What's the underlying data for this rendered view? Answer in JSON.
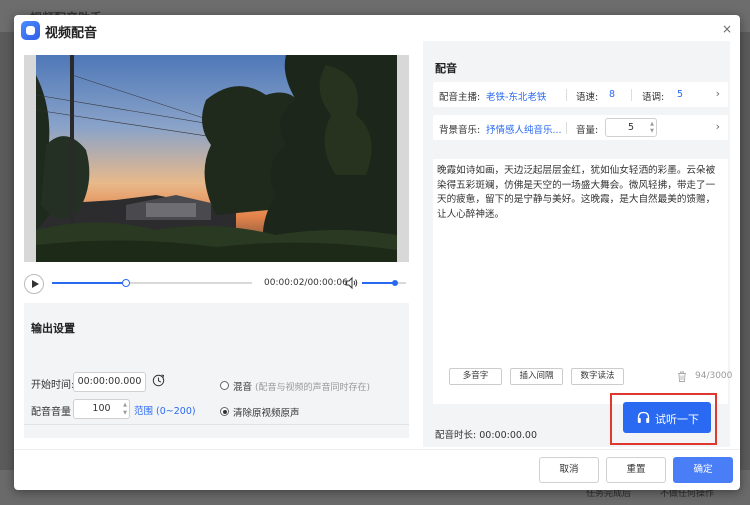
{
  "background": {
    "app_title": "视频配音助手",
    "bottom_status": "任务完成后",
    "bottom_option": "不做任何操作"
  },
  "dialog": {
    "title": "视频配音",
    "close_icon": "×"
  },
  "player": {
    "time_display": "00:00:02/00:00:06",
    "progress": 0.37,
    "volume": 0.75
  },
  "output": {
    "title": "输出设置",
    "start_time_label": "开始时间:",
    "start_time_value": "00:00:00.000",
    "dub_volume_label": "配音音量",
    "dub_volume_value": "100",
    "range_label": "范围",
    "range_hint": "(0~200)",
    "mix_label": "混音",
    "mix_hint": "(配音与视频的声音同时存在)",
    "remove_label": "清除原视频原声",
    "selected_mode": "remove"
  },
  "dub": {
    "title": "配音",
    "anchor_label": "配音主播:",
    "anchor_value": "老铁-东北老铁",
    "speed_label": "语速:",
    "speed_value": "8",
    "pitch_label": "语调:",
    "pitch_value": "5",
    "bgm_label": "背景音乐:",
    "bgm_value": "抒情感人纯音乐...",
    "volume_label": "音量:",
    "volume_value": "5",
    "text": "晚霞如诗如画，天边泛起层层金红，犹如仙女轻洒的彩墨。云朵被染得五彩斑斓，仿佛是天空的一场盛大舞会。微风轻拂，带走了一天的疲惫，留下的是宁静与美好。这晚霞，是大自然最美的馈赠，让人心醉神迷。",
    "polyphone_btn": "多音字",
    "pause_btn": "插入间隔",
    "number_btn": "数字读法",
    "char_count": "94/3000",
    "duration_label": "配音时长:",
    "duration_value": "00:00:00.00",
    "listen_btn": "试听一下"
  },
  "footer": {
    "cancel": "取消",
    "reset": "重置",
    "confirm": "确定"
  },
  "colors": {
    "accent": "#2a6af3",
    "highlight_border": "#e0372f",
    "panel_bg": "#f3f4f6"
  }
}
